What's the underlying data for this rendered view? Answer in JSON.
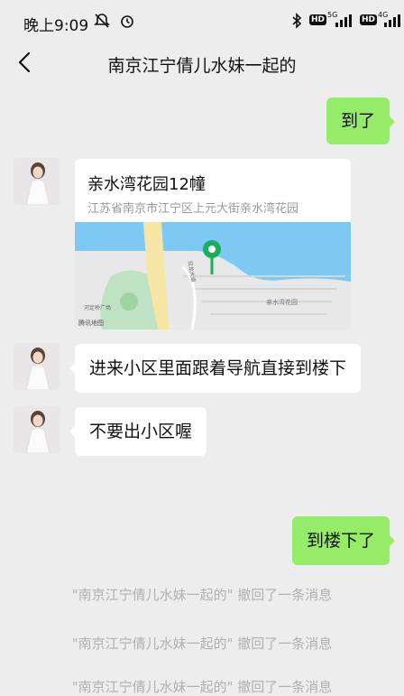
{
  "status_bar": {
    "time": "晚上9:09",
    "network1": "HD",
    "network1_type": "5G",
    "network2": "HD",
    "network2_type": "4G"
  },
  "header": {
    "title": "南京江宁倩儿水妹一起的"
  },
  "messages": {
    "m1": "到了",
    "location": {
      "name": "亲水湾花园12幢",
      "address": "江苏省南京市江宁区上元大街亲水湾花园",
      "map_attribution": "腾讯地图",
      "map_labels": {
        "road1": "双龙大道",
        "road2": "双龙大道辅路",
        "road3": "湖滨路",
        "park": "河定桥广场",
        "poi": "亲水湾花园"
      }
    },
    "m2": "进来小区里面跟着导航直接到楼下",
    "m3": "不要出小区喔",
    "m4": "到楼下了",
    "recall1": "\"南京江宁倩儿水妹一起的\" 撤回了一条消息",
    "recall2": "\"南京江宁倩儿水妹一起的\" 撤回了一条消息",
    "recall3": "\"南京江宁倩儿水妹一起的\" 撤回了一条消息"
  },
  "colors": {
    "bg": "#ededed",
    "self_bubble": "#95ec69",
    "other_bubble": "#ffffff",
    "map_water": "#7ec8f4",
    "map_land": "#e6e6e6",
    "map_pin": "#1aad5a"
  }
}
